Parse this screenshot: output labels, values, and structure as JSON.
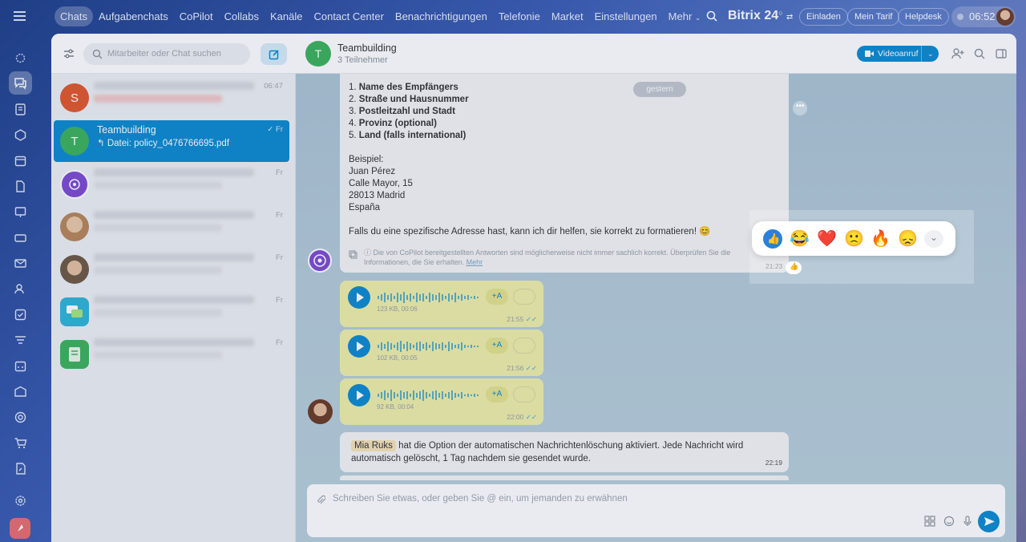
{
  "nav": {
    "items": [
      "Chats",
      "Aufgabenchats",
      "CoPilot",
      "Collabs",
      "Kanäle",
      "Contact Center",
      "Benachrichtigungen",
      "Telefonie",
      "Market",
      "Einstellungen",
      "Mehr"
    ],
    "brand": "Bitrix 24",
    "invite": "Einladen",
    "plan": "Mein Tarif",
    "helpdesk": "Helpdesk",
    "time": "06:52"
  },
  "sidebar": {
    "search_placeholder": "Mitarbeiter oder Chat suchen",
    "chats": [
      {
        "initial": "S",
        "name": "",
        "sub": "",
        "time": "06:47",
        "color": "#e2572c"
      },
      {
        "initial": "T",
        "name": "Teambuilding",
        "sub": "Datei: policy_0476766695.pdf",
        "time": "Fr",
        "color": "#3db35c"
      },
      {
        "initial": "",
        "name": "",
        "sub": "",
        "time": "Fr",
        "color": "#7e4bd1"
      },
      {
        "initial": "",
        "name": "",
        "sub": "",
        "time": "Fr",
        "color": "#c9a27a"
      },
      {
        "initial": "",
        "name": "",
        "sub": "",
        "time": "Fr",
        "color": "#8b6b4b"
      },
      {
        "initial": "",
        "name": "",
        "sub": "",
        "time": "Fr",
        "color": "#2fb5d6"
      },
      {
        "initial": "",
        "name": "",
        "sub": "",
        "time": "Fr",
        "color": "#3db35c"
      }
    ]
  },
  "chat": {
    "title": "Teambuilding",
    "subtitle": "3 Teilnehmer",
    "video_button": "Videoanruf",
    "date_pill": "gestern",
    "big_message": {
      "list": [
        {
          "n": "1.",
          "t": "Name des Empfängers"
        },
        {
          "n": "2.",
          "t": "Straße und Hausnummer"
        },
        {
          "n": "3.",
          "t": "Postleitzahl und Stadt"
        },
        {
          "n": "4.",
          "t": "Provinz (optional)"
        },
        {
          "n": "5.",
          "t": "Land (falls international)"
        }
      ],
      "example_label": "Beispiel:",
      "example_lines": [
        "Juan Pérez",
        "Calle Mayor, 15",
        "28013 Madrid",
        "España"
      ],
      "closing": "Falls du eine spezifische Adresse hast, kann ich dir helfen, sie korrekt zu formatieren! 😊",
      "disclaimer": "Die von CoPilot bereitgestellten Antworten sind möglicherweise nicht immer sachlich korrekt. Überprüfen Sie die Informationen, die Sie erhalten.",
      "disclaimer_link": "Mehr",
      "time": "21:23"
    },
    "voice_messages": [
      {
        "meta": "123 KB, 00:06",
        "time": "21:55",
        "translate": "+A"
      },
      {
        "meta": "102 KB, 00:05",
        "time": "21:56",
        "translate": "+A"
      },
      {
        "meta": "92 KB, 00:04",
        "time": "22:00",
        "translate": "+A"
      }
    ],
    "system_message": {
      "name": "Mia Ruks",
      "text": " hat die Option der automatischen Nachrichtenlöschung aktiviert. Jede Nachricht wird automatisch gelöscht, 1 Tag nachdem sie gesendet wurde.",
      "time": "22:19"
    },
    "composer_placeholder": "Schreiben Sie etwas, oder geben Sie @ ein, um jemanden zu erwähnen",
    "reactions": [
      "👍",
      "😂",
      "❤️",
      "🙁",
      "🔥",
      "😞"
    ]
  },
  "colors": {
    "accent": "#0d8bd0",
    "green": "#3db35c",
    "voice_bg": "#efefa9"
  }
}
